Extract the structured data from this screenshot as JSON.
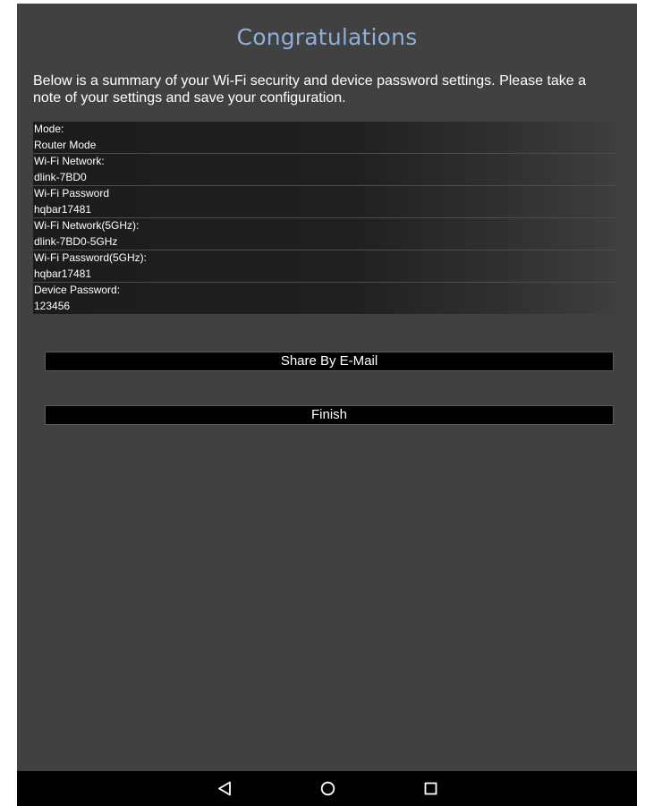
{
  "title": "Congratulations",
  "summary": "Below is a summary of your Wi-Fi security and device password settings. Please take a note of your settings and save your configuration.",
  "settings": [
    {
      "label": "Mode:",
      "value": "Router Mode"
    },
    {
      "label": "Wi-Fi Network:",
      "value": "dlink-7BD0"
    },
    {
      "label": "Wi-Fi Password",
      "value": "hqbar17481"
    },
    {
      "label": "Wi-Fi Network(5GHz):",
      "value": "dlink-7BD0-5GHz"
    },
    {
      "label": "Wi-Fi Password(5GHz):",
      "value": "hqbar17481"
    },
    {
      "label": "Device Password:",
      "value": "123456"
    }
  ],
  "buttons": {
    "share": "Share By E-Mail",
    "finish": "Finish"
  },
  "navbar": {
    "back_icon": "back-triangle-icon",
    "home_icon": "home-circle-icon",
    "recent_icon": "recent-apps-square-icon"
  },
  "colors": {
    "title": "#8eaedb",
    "background": "#414141",
    "button_bg": "#000000"
  }
}
